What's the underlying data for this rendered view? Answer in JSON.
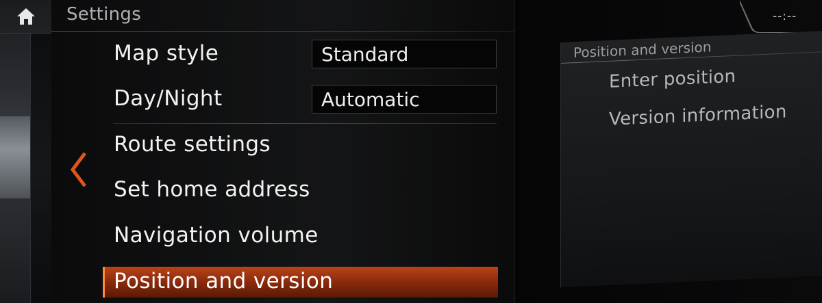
{
  "header": {
    "title": "Settings",
    "clock": "--:--",
    "home_icon": "home-icon"
  },
  "menu": {
    "items": [
      {
        "label": "Map style",
        "value": "Standard"
      },
      {
        "label": "Day/Night",
        "value": "Automatic"
      },
      {
        "label": "Route settings"
      },
      {
        "label": "Set home address"
      },
      {
        "label": "Navigation volume"
      },
      {
        "label": "Position and version",
        "selected": true
      }
    ],
    "back_icon": "chevron-left-icon"
  },
  "submenu": {
    "title": "Position and version",
    "items": [
      {
        "label": "Enter position"
      },
      {
        "label": "Version information"
      }
    ]
  },
  "colors": {
    "accent": "#e0551c",
    "highlight": "#b9431a",
    "text": "#f2f2f2",
    "muted": "#aeb2b6"
  }
}
